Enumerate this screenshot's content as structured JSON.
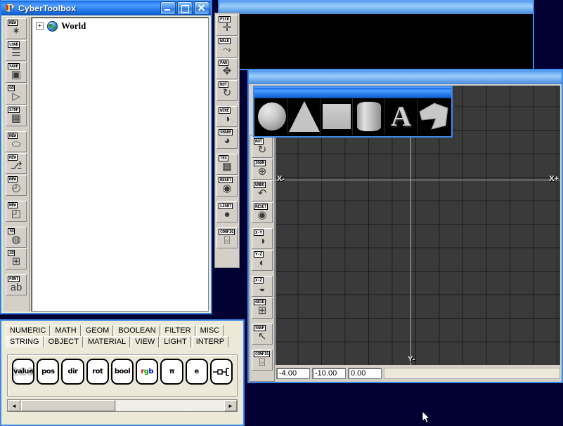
{
  "desktop": {
    "background_color": "#000033"
  },
  "main_window": {
    "title": "CyberToolbox",
    "app_icon": "palette-icon",
    "buttons": {
      "minimize": "minimize-button",
      "maximize": "maximize-button",
      "close": "close-button"
    },
    "tree": {
      "expander": "+",
      "node_icon": "globe-icon",
      "root_label": "World"
    },
    "toolbar": [
      {
        "cap": "NEW",
        "glyph": "✶",
        "name": "new-scene"
      },
      {
        "cap": "LOAD",
        "glyph": "☰",
        "name": "load-scene"
      },
      {
        "cap": "SAVE",
        "glyph": "▣",
        "name": "save-scene"
      },
      {
        "cap": "GO",
        "glyph": "▷",
        "name": "run"
      },
      {
        "cap": "STOP",
        "glyph": "▦",
        "name": "stop"
      },
      {
        "cap": "NEW",
        "glyph": "⬭",
        "name": "new-object"
      },
      {
        "cap": "NEW",
        "glyph": "⎇",
        "name": "new-link"
      },
      {
        "cap": "NEW",
        "glyph": "◴",
        "name": "new-timer"
      },
      {
        "cap": "NEW",
        "glyph": "◰",
        "name": "new-page"
      },
      {
        "cap": "3D",
        "glyph": "◍",
        "name": "new-3d-view"
      },
      {
        "cap": "2D",
        "glyph": "⊞",
        "name": "new-2d-view"
      },
      {
        "cap": "FONT",
        "glyph": "ab",
        "name": "new-font"
      }
    ]
  },
  "render_window": {
    "title": "",
    "canvas": "render-canvas"
  },
  "nav_toolbar": {
    "name": "navigation-toolbar",
    "buttons": [
      {
        "cap": "PICK",
        "glyph": "✛",
        "name": "pick-tool"
      },
      {
        "cap": "WALK",
        "glyph": "⤳",
        "name": "walk-tool"
      },
      {
        "cap": "PAN",
        "glyph": "✥",
        "name": "pan-tool"
      },
      {
        "cap": "ROT",
        "glyph": "↻",
        "name": "rotate-tool"
      },
      {
        "cap": "WIRE",
        "glyph": "◑",
        "name": "wireframe-mode"
      },
      {
        "cap": "SHADE",
        "glyph": "◕",
        "name": "shaded-mode"
      },
      {
        "cap": "TEX",
        "glyph": "▦",
        "name": "textured-mode"
      },
      {
        "cap": "RESET",
        "glyph": "◉",
        "name": "reset-view"
      },
      {
        "cap": "LIGHT",
        "glyph": "●",
        "name": "light-tool"
      },
      {
        "cap": "CONFIG",
        "glyph": "⌸",
        "name": "configure-view"
      }
    ]
  },
  "edit_toolbar": {
    "name": "edit-toolbar",
    "buttons": [
      {
        "cap": "ROT",
        "glyph": "↻",
        "name": "rotate-tool"
      },
      {
        "cap": "ZOOM",
        "glyph": "⊕",
        "name": "zoom-tool"
      },
      {
        "cap": "UNDO",
        "glyph": "↶",
        "name": "undo"
      },
      {
        "cap": "RESET",
        "glyph": "◉",
        "name": "reset-view"
      },
      {
        "cap": "X-Y",
        "glyph": "◑",
        "name": "view-xy-plane"
      },
      {
        "cap": "Y-Z",
        "glyph": "◐",
        "name": "view-yz-plane"
      },
      {
        "cap": "X-Z",
        "glyph": "◒",
        "name": "view-xz-plane"
      },
      {
        "cap": "GRID",
        "glyph": "⊞",
        "name": "toggle-grid"
      },
      {
        "cap": "SNAP",
        "glyph": "↖",
        "name": "toggle-snap"
      },
      {
        "cap": "CONFIG",
        "glyph": "⌸",
        "name": "configure-editor"
      }
    ]
  },
  "shape_palette": {
    "title": "",
    "shapes": [
      {
        "name": "sphere-shape",
        "label": "sphere"
      },
      {
        "name": "cone-shape",
        "label": "cone"
      },
      {
        "name": "cube-shape",
        "label": "cube"
      },
      {
        "name": "cylinder-shape",
        "label": "cylinder"
      },
      {
        "name": "text-shape",
        "label": "A"
      },
      {
        "name": "polygon-shape",
        "label": "polygon"
      }
    ]
  },
  "viewport": {
    "title": "",
    "axis_labels": {
      "left": "X-",
      "right": "X+",
      "bottom": "Y-"
    },
    "grid_color": "#3a3a3a",
    "axis_color": "#b8b8b8",
    "status": {
      "x": "-4.00",
      "y": "-10.00",
      "z": "0.00",
      "extra": ""
    }
  },
  "node_palette": {
    "tab_rows": [
      [
        "NUMERIC",
        "MATH",
        "GEOM",
        "BOOLEAN",
        "FILTER",
        "MISC"
      ],
      [
        "STRING",
        "OBJECT",
        "MATERIAL",
        "VIEW",
        "LIGHT",
        "INTERP"
      ]
    ],
    "selected_tab": "STRING",
    "nodes": [
      {
        "label": "value",
        "ghost": "123",
        "name": "node-value"
      },
      {
        "label": "pos",
        "ghost": "",
        "name": "node-pos"
      },
      {
        "label": "dir",
        "ghost": "",
        "name": "node-dir"
      },
      {
        "label": "rot",
        "ghost": "",
        "name": "node-rot"
      },
      {
        "label": "bool",
        "ghost": "",
        "name": "node-bool"
      },
      {
        "label": "rgb",
        "ghost": "",
        "name": "node-rgb"
      },
      {
        "label": "π",
        "ghost": "",
        "name": "node-pi"
      },
      {
        "label": "e",
        "ghost": "",
        "name": "node-e"
      },
      {
        "label": "",
        "ghost": "",
        "name": "node-connector"
      }
    ],
    "scroll": {
      "left_arrow": "◄",
      "right_arrow": "►"
    }
  }
}
